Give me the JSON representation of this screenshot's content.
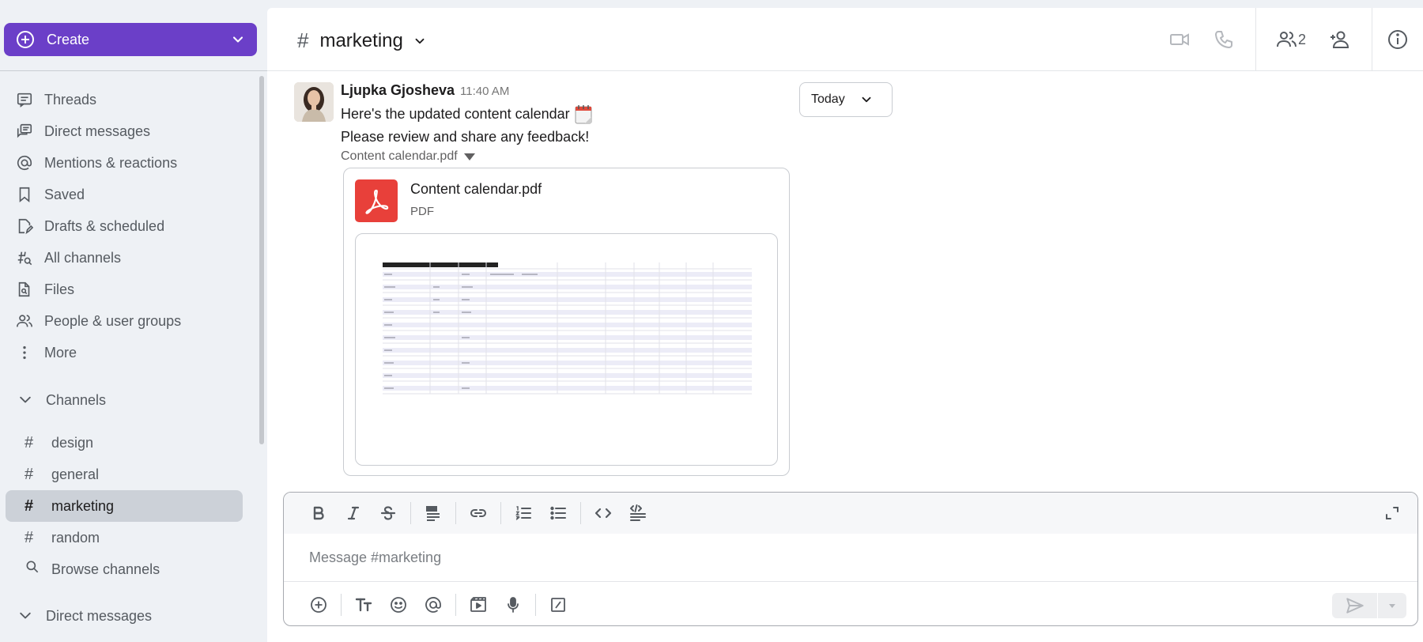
{
  "sidebar": {
    "create_label": "Create",
    "nav_items": [
      {
        "label": "Threads",
        "icon": "threads-icon"
      },
      {
        "label": "Direct messages",
        "icon": "direct-messages-icon"
      },
      {
        "label": "Mentions & reactions",
        "icon": "at-icon"
      },
      {
        "label": "Saved",
        "icon": "bookmark-icon"
      },
      {
        "label": "Drafts & scheduled",
        "icon": "draft-icon"
      },
      {
        "label": "All channels",
        "icon": "channel-search-icon"
      },
      {
        "label": "Files",
        "icon": "file-search-icon"
      },
      {
        "label": "People & user groups",
        "icon": "people-icon"
      },
      {
        "label": "More",
        "icon": "more-vertical-icon"
      }
    ],
    "channels_header": "Channels",
    "channels": [
      {
        "label": "design",
        "active": false
      },
      {
        "label": "general",
        "active": false
      },
      {
        "label": "marketing",
        "active": true
      },
      {
        "label": "random",
        "active": false
      }
    ],
    "browse_label": "Browse channels",
    "dm_header": "Direct messages"
  },
  "header": {
    "hash": "#",
    "channel_name": "marketing",
    "member_count": "2"
  },
  "message": {
    "author": "Ljupka Gjosheva",
    "time": "11:40 AM",
    "line1": "Here's the updated content calendar",
    "line2": "Please review and share any feedback!",
    "attachment_toggle": "Content calendar.pdf",
    "file": {
      "name": "Content calendar.pdf",
      "type": "PDF"
    }
  },
  "date_divider": "Today",
  "composer": {
    "placeholder": "Message #marketing"
  },
  "colors": {
    "brand": "#6b3fc8",
    "sidebar_bg": "#eef1f5",
    "active_channel_bg": "#ccd1d8",
    "pdf_red": "#e8403a"
  }
}
